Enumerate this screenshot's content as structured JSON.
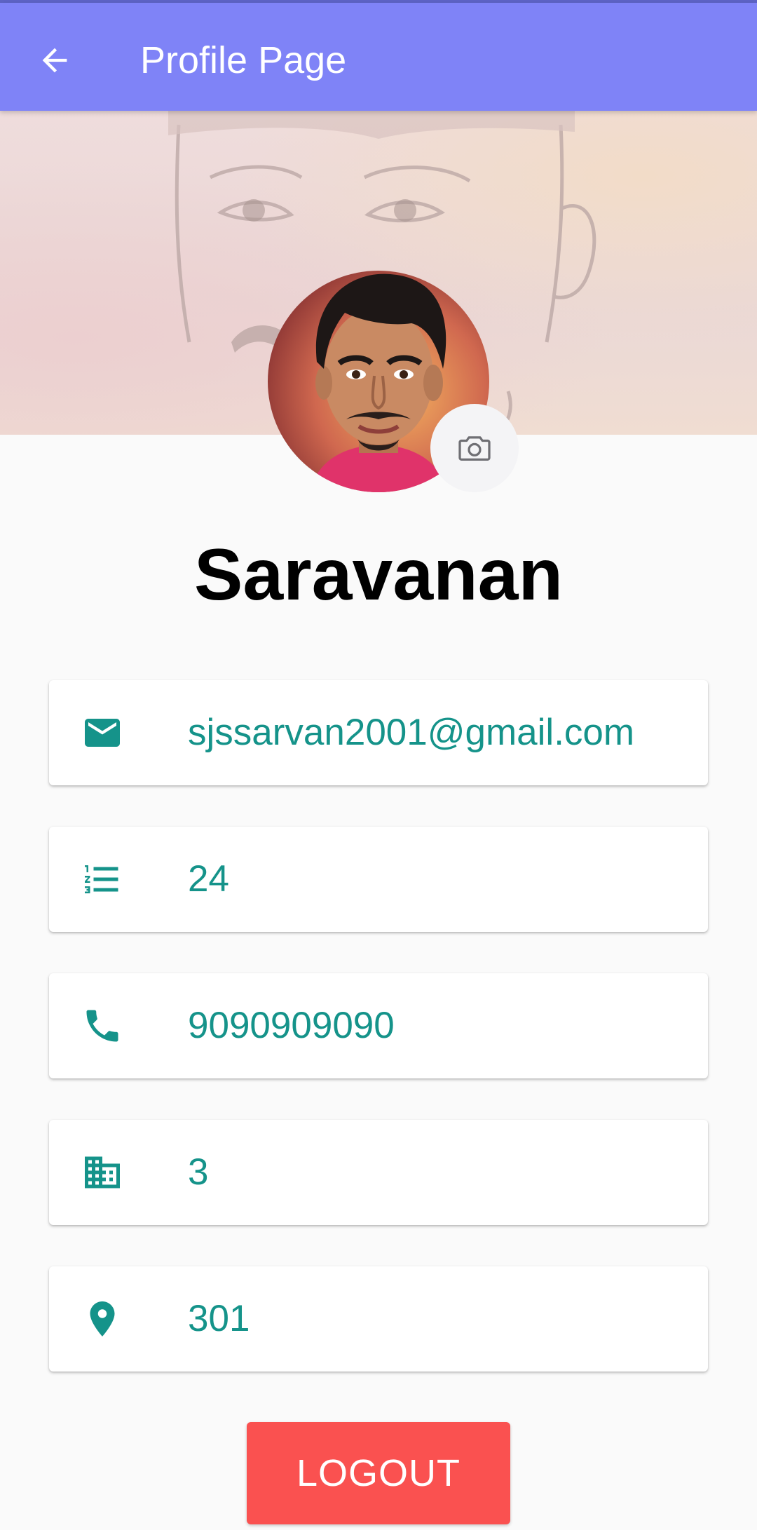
{
  "appbar": {
    "title": "Profile Page",
    "back_icon": "arrow-back-icon",
    "color": "#7f83f7"
  },
  "profile": {
    "name": "Saravanan",
    "camera_icon": "camera-icon"
  },
  "fields": [
    {
      "icon": "email-icon",
      "value": "sjssarvan2001@gmail.com"
    },
    {
      "icon": "numbered-list-icon",
      "value": "24"
    },
    {
      "icon": "phone-icon",
      "value": "9090909090"
    },
    {
      "icon": "building-icon",
      "value": "3"
    },
    {
      "icon": "location-pin-icon",
      "value": "301"
    }
  ],
  "actions": {
    "logout_label": "LOGOUT",
    "logout_color": "#fa5150"
  },
  "colors": {
    "accent": "#15938a"
  }
}
